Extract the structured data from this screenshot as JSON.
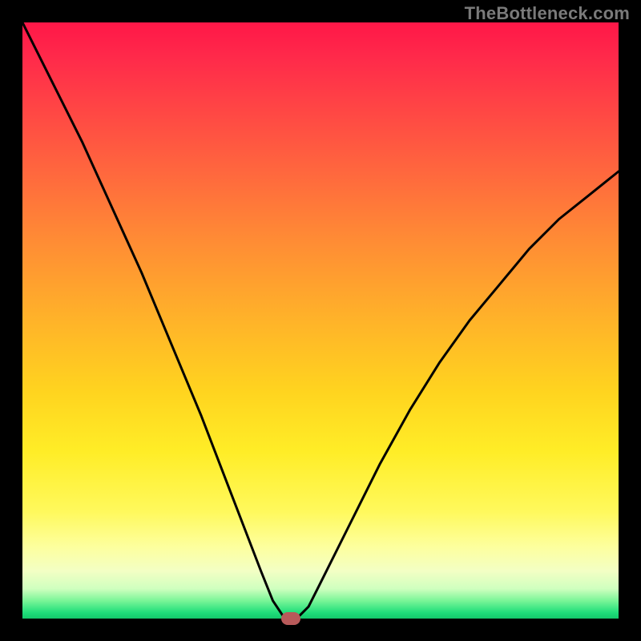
{
  "watermark": "TheBottleneck.com",
  "chart_data": {
    "type": "line",
    "title": "",
    "xlabel": "",
    "ylabel": "",
    "xlim": [
      0,
      1
    ],
    "ylim": [
      0,
      1
    ],
    "x": [
      0.0,
      0.05,
      0.1,
      0.15,
      0.2,
      0.25,
      0.3,
      0.35,
      0.4,
      0.42,
      0.44,
      0.46,
      0.48,
      0.5,
      0.55,
      0.6,
      0.65,
      0.7,
      0.75,
      0.8,
      0.85,
      0.9,
      0.95,
      1.0
    ],
    "values": [
      1.0,
      0.9,
      0.8,
      0.69,
      0.58,
      0.46,
      0.34,
      0.21,
      0.08,
      0.03,
      0.0,
      0.0,
      0.02,
      0.06,
      0.16,
      0.26,
      0.35,
      0.43,
      0.5,
      0.56,
      0.62,
      0.67,
      0.71,
      0.75
    ],
    "marker": {
      "x": 0.45,
      "y": 0.0
    },
    "background_gradient": {
      "top": "#ff1748",
      "mid": "#ffd41f",
      "bottom": "#14c86b"
    }
  }
}
